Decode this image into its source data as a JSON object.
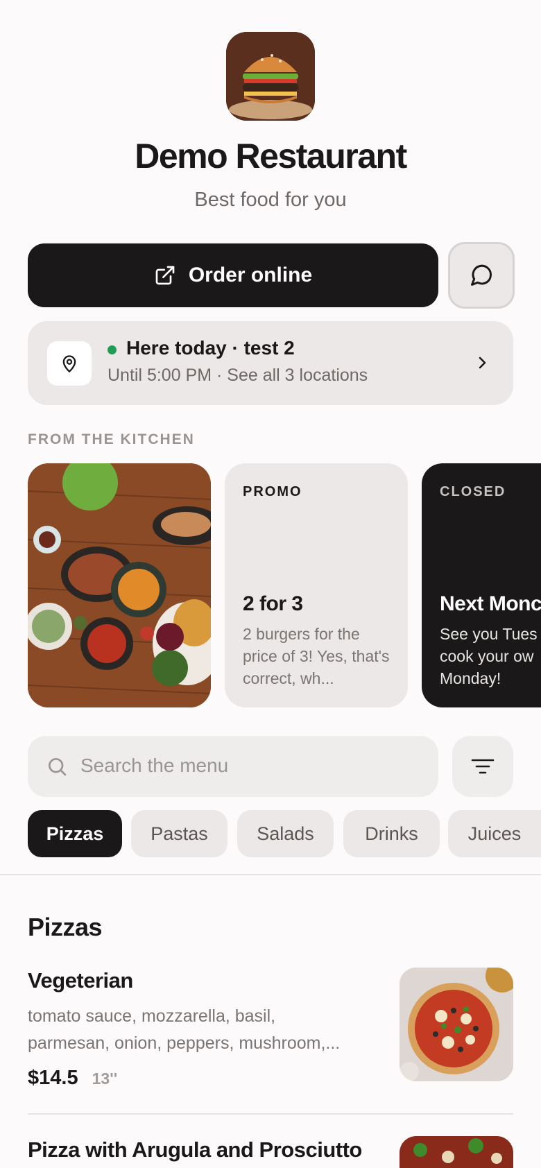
{
  "header": {
    "title": "Demo Restaurant",
    "tagline": "Best food for you"
  },
  "actions": {
    "order_label": "Order online",
    "order_icon": "external-link-icon",
    "chat_icon": "chat-bubble-icon"
  },
  "location": {
    "status_color": "#1f9d55",
    "title": "Here today · test 2",
    "subtitle": "Until 5:00 PM · See all 3 locations"
  },
  "kitchen": {
    "label": "FROM THE KITCHEN",
    "cards": [
      {
        "type": "image",
        "image": "food-spread-photo"
      },
      {
        "label": "PROMO",
        "headline": "2 for 3",
        "body": "2 burgers for the price of 3! Yes, that's correct, wh..."
      },
      {
        "label": "CLOSED",
        "headline": "Next Monc",
        "body": "See you Tues cook your ow Monday!"
      }
    ]
  },
  "search": {
    "placeholder": "Search the menu"
  },
  "categories": [
    "Pizzas",
    "Pastas",
    "Salads",
    "Drinks",
    "Juices"
  ],
  "active_category": "Pizzas",
  "menu": {
    "section_title": "Pizzas",
    "items": [
      {
        "name": "Vegeterian",
        "desc_line1": "tomato sauce, mozzarella, basil,",
        "desc_line2": "parmesan, onion, peppers, mushroom,...",
        "price": "$14.5",
        "size": "13''"
      },
      {
        "name": "Pizza with Arugula and Prosciutto"
      }
    ]
  },
  "colors": {
    "accent": "#1a1818",
    "background": "#fcfafa",
    "card": "#ebe8e7",
    "open": "#1f9d55"
  }
}
